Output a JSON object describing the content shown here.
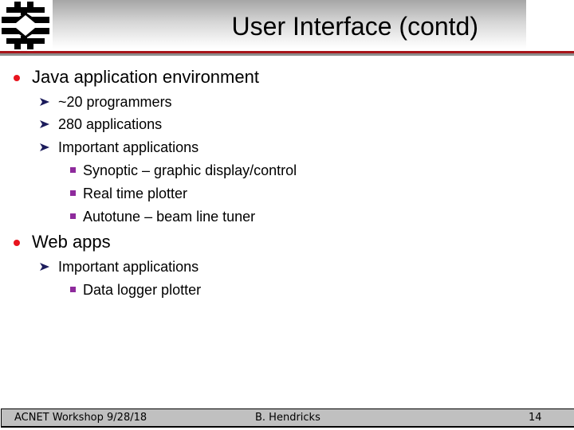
{
  "slide": {
    "title": "User Interface (contd)",
    "logo": "fermilab-logo",
    "colors": {
      "rule_red": "#a8141a",
      "rule_gray": "#8c8c8c",
      "bullet_red": "#e8141e",
      "arrow_navy": "#1c1c5c",
      "square_purple": "#8e2a9c",
      "footer_bg": "#c0c0c0"
    },
    "bullets": [
      {
        "text": "Java application environment",
        "icon": "red-dot-bullet",
        "children": [
          {
            "text": "~20 programmers",
            "icon": "arrow-bullet"
          },
          {
            "text": "280 applications",
            "icon": "arrow-bullet"
          },
          {
            "text": "Important applications",
            "icon": "arrow-bullet",
            "children": [
              {
                "text": "Synoptic – graphic display/control",
                "icon": "square-bullet"
              },
              {
                "text": "Real time plotter",
                "icon": "square-bullet"
              },
              {
                "text": "Autotune – beam line tuner",
                "icon": "square-bullet"
              }
            ]
          }
        ]
      },
      {
        "text": "Web apps",
        "icon": "red-dot-bullet",
        "children": [
          {
            "text": "Important applications",
            "icon": "arrow-bullet",
            "children": [
              {
                "text": "Data logger plotter",
                "icon": "square-bullet"
              }
            ]
          }
        ]
      }
    ]
  },
  "footer": {
    "left": "ACNET Workshop 9/28/18",
    "center": "B. Hendricks",
    "page_number": "14"
  }
}
